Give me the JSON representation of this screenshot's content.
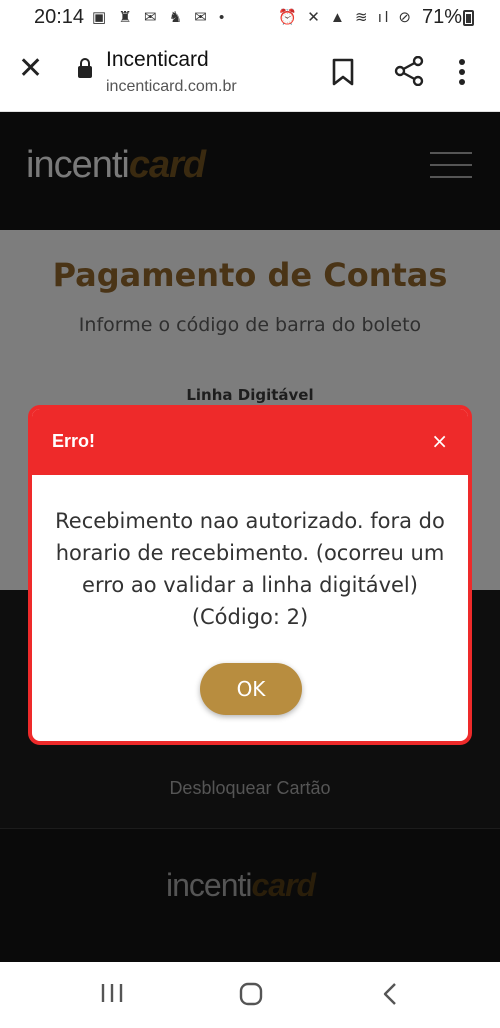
{
  "status_bar": {
    "time": "20:14",
    "battery": "71%"
  },
  "browser": {
    "title": "Incenticard",
    "url": "incenticard.com.br"
  },
  "site": {
    "logo_part1": "incenti",
    "logo_part2": "card",
    "page_title": "Pagamento de Contas",
    "page_subtitle": "Informe o código de barra do boleto",
    "field_label": "Linha Digitável",
    "unlock_link": "Desbloquear Cartão"
  },
  "dialog": {
    "title": "Erro!",
    "close": "×",
    "message": "Recebimento nao autorizado. fora do horario de recebimento. (ocorreu um erro ao validar a linha digitável)(Código: 2)",
    "ok_label": "OK"
  },
  "icons": {
    "close": "close-icon",
    "lock": "lock-icon",
    "bookmark": "bookmark-icon",
    "share": "share-icon",
    "menu": "more-vert-icon",
    "hamburger": "hamburger-menu-icon",
    "recent": "recent-apps-icon",
    "home": "home-icon",
    "back": "back-icon"
  },
  "colors": {
    "dialog_red": "#ee2a2a",
    "ok_gold": "#b88d3f",
    "title_brown": "#4a3416"
  }
}
